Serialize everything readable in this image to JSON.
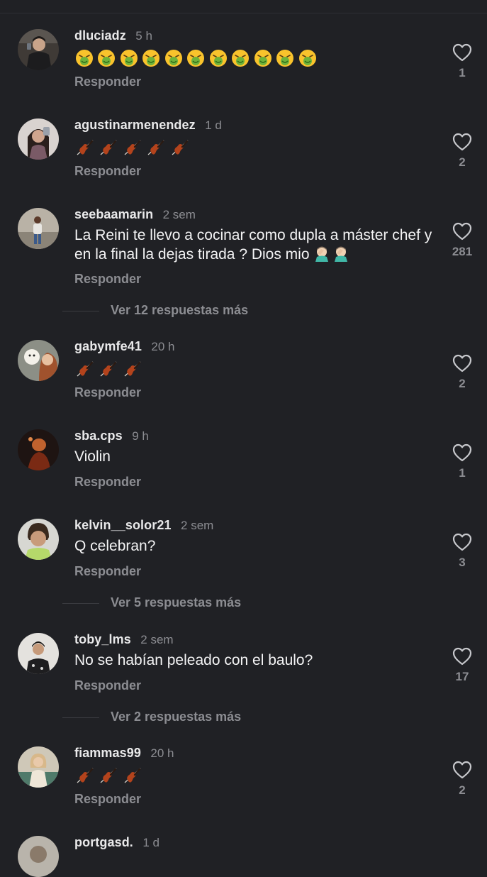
{
  "comments": [
    {
      "username": "dluciadz",
      "time": "5 h",
      "emoji_icon": "nauseated-face-icon",
      "emoji_count": 11,
      "reply_label": "Responder",
      "likes": "1"
    },
    {
      "username": "agustinarmenendez",
      "time": "1 d",
      "emoji_icon": "violin-icon",
      "emoji_count": 5,
      "reply_label": "Responder",
      "likes": "2"
    },
    {
      "username": "seebaamarin",
      "time": "2 sem",
      "text": "La Reini te llevo a cocinar como dupla a máster chef y en la final la dejas tirada ? Dios mio",
      "trailing_emoji_icon": "man-facepalming-icon",
      "reply_label": "Responder",
      "likes": "281",
      "more_replies": "Ver 12 respuestas más"
    },
    {
      "username": "gabymfe41",
      "time": "20 h",
      "emoji_icon": "violin-icon",
      "emoji_count": 3,
      "reply_label": "Responder",
      "likes": "2"
    },
    {
      "username": "sba.cps",
      "time": "9 h",
      "text": "Violin",
      "reply_label": "Responder",
      "likes": "1"
    },
    {
      "username": "kelvin__solor21",
      "time": "2 sem",
      "text": "Q celebran?",
      "reply_label": "Responder",
      "likes": "3",
      "more_replies": "Ver 5 respuestas más"
    },
    {
      "username": "toby_lms",
      "time": "2 sem",
      "text": "No se habían peleado con el baulo?",
      "reply_label": "Responder",
      "likes": "17",
      "more_replies": "Ver 2 respuestas más"
    },
    {
      "username": "fiammas99",
      "time": "20 h",
      "emoji_icon": "violin-icon",
      "emoji_count": 3,
      "reply_label": "Responder",
      "likes": "2"
    },
    {
      "username": "portgasd.",
      "time": "1 d"
    }
  ],
  "colors": {
    "background": "#202125",
    "username": "#e9e9ea",
    "secondary_text": "#8c8d92",
    "body_text": "#f4f4f5"
  }
}
